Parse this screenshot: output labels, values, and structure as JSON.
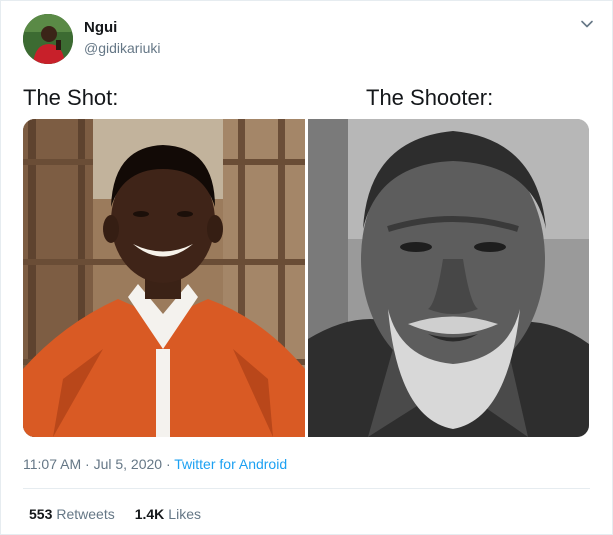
{
  "user": {
    "display_name": "Ngui",
    "handle": "@gidikariuki"
  },
  "icons": {
    "more": "chevron-down-icon"
  },
  "tweet": {
    "caption_left": "The Shot:",
    "caption_right": "The Shooter:",
    "time": "11:07 AM",
    "separator": "·",
    "date": "Jul 5, 2020",
    "source": "Twitter for Android"
  },
  "stats": {
    "retweets_count": "553",
    "retweets_label": "Retweets",
    "likes_count": "1.4K",
    "likes_label": "Likes"
  },
  "colors": {
    "link": "#1da1f2",
    "secondary_text": "#657786",
    "jacket": "#d95a24"
  }
}
